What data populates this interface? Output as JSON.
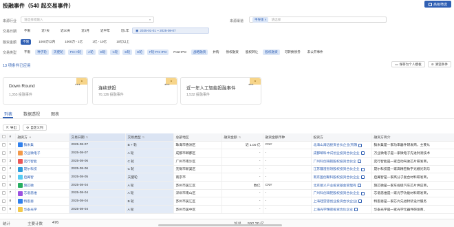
{
  "header": {
    "title": "投融事件（540 起交易事件）",
    "advanced_label": "高级筛选"
  },
  "filters": {
    "industry": {
      "label": "来源行业",
      "placeholder": "请选择或输入"
    },
    "channel": {
      "label": "来源渠道",
      "tag": "半导体",
      "placeholder": "请选择"
    },
    "date": {
      "label": "交易日期",
      "options": [
        "不限",
        "近7天",
        "近30天",
        "近3月",
        "近半年",
        "近1年"
      ],
      "range": "2025-01-01 ~ 2025-08-07"
    },
    "amount": {
      "label": "融资金额",
      "options": [
        "不限",
        "1000万以内",
        "1000万 - 1亿",
        "1亿 - 10亿",
        "10亿以上"
      ]
    },
    "round": {
      "label": "交易类型",
      "options": [
        "不限",
        "种子轮",
        "天使轮",
        "Pre-A轮",
        "A轮",
        "B轮",
        "C轮",
        "D轮",
        "E轮",
        "F轮-Pre IPO",
        "Post-IPO",
        "战略融资",
        "并购",
        "债权融资",
        "股权转让",
        "股权融资",
        "可转换债券",
        "未公开事件"
      ]
    }
  },
  "summary": {
    "count_text": "13 项条件已应用",
    "save_label": "保存为个人模板",
    "clear_label": "清空条件"
  },
  "cards": [
    {
      "name": "Down Round",
      "count": "1,355 投融事件",
      "more": "•••"
    },
    {
      "name": "连续获投",
      "count": "70,136 投融事件",
      "more": "•••"
    },
    {
      "name": "近一年人工智能投融事件",
      "count": "1,532 投融事件",
      "more": "•••"
    }
  ],
  "tabs": [
    "列表",
    "数据透视",
    "图表"
  ],
  "table_toolbar": {
    "export": "导出",
    "custom_cols": "自定义列"
  },
  "table": {
    "columns": [
      "#",
      "融资方",
      "交易日期",
      "交易类型",
      "总部地区",
      "融资金额",
      "融资金额币种",
      "投资方",
      "融资方简介"
    ],
    "rows": [
      {
        "idx": "1",
        "name": "猿米集",
        "date": "2025-08-07",
        "type": "B + 轮",
        "region": "珠海市香洲区",
        "amount": "近 1.00 亿",
        "currency": "CNY",
        "investor": "北海山海远投资合伙企业(有限",
        "desc": "猿米集是一家功率器件研发商，主要从",
        "logo": "#2f80ed"
      },
      {
        "idx": "2",
        "name": "万业微电子",
        "date": "2025-08-07",
        "type": "A 轮",
        "region": "成都市郫都区",
        "amount": "-",
        "currency": "-",
        "investor": "成都郫科中试创业投资合伙企业",
        "desc": "万业微电子是一家微电子先进封测技术",
        "logo": "#f2994a"
      },
      {
        "idx": "3",
        "name": "奕行智能",
        "date": "2025-08-06",
        "type": "C 轮",
        "region": "广州市南沙区",
        "amount": "-",
        "currency": "-",
        "investor": "广州科创海钜股权投资合伙企",
        "desc": "奕行智能是一家自动驾驶芯片研发商，",
        "logo": "#eb5757"
      },
      {
        "idx": "4",
        "name": "晟尔科技",
        "date": "2025-08-06",
        "type": "C 轮",
        "region": "无锡市新吴区",
        "amount": "-",
        "currency": "-",
        "investor": "江苏疆澄智领股权投资合伙企业",
        "desc": "晟尔科技是一家高精密数字光栅光刻与",
        "logo": "#2d9cdb"
      },
      {
        "idx": "5",
        "name": "启翼智",
        "date": "2025-08-05",
        "type": "天使轮",
        "region": "南京市",
        "amount": "-",
        "currency": "-",
        "investor": "南京国创聚科股权投资合伙企业",
        "desc": "启翼智是一家高分子复合材料研发商，",
        "logo": "#56ccf2"
      },
      {
        "idx": "6",
        "name": "旗芯微",
        "date": "2025-08-04",
        "type": "A 轮",
        "region": "苏州市吴江区",
        "amount": "数亿",
        "currency": "CNY",
        "investor": "北京顺义产业投资基金管理有",
        "desc": "旗芯微是一家车规级汽车芯片供应商，",
        "logo": "#27ae60"
      },
      {
        "idx": "7",
        "name": "芯谐思维",
        "date": "2025-08-04",
        "type": "A 轮",
        "region": "深圳市南山区",
        "amount": "-",
        "currency": "-",
        "investor": "广州科创海钜股权投资合伙企业",
        "desc": "芯谐思维是一家光学功能材料研发商，",
        "logo": "#9b51e0"
      },
      {
        "idx": "8",
        "name": "特思恩",
        "date": "2025-08-04",
        "type": "B 轮",
        "region": "苏州市吴江区",
        "amount": "-",
        "currency": "-",
        "investor": "上海硅望思创业投资合伙企业(",
        "desc": "特思恩是一家芯片先进封装设计服务",
        "logo": "#2f80ed"
      },
      {
        "idx": "9",
        "name": "华泰光学",
        "date": "2025-08-04",
        "type": "A 轮",
        "region": "苏州市吴中区",
        "amount": "-",
        "currency": "-",
        "investor": "上海光学精密投资合伙企业",
        "desc": "华泰光学是一家光学元器件研发商，",
        "logo": "#f2c94c"
      }
    ]
  },
  "footer": {
    "label": "统计",
    "main_count_label": "主要计数",
    "main_count": "476",
    "sum_label": "加总",
    "sum_value": "592.20 亿"
  }
}
